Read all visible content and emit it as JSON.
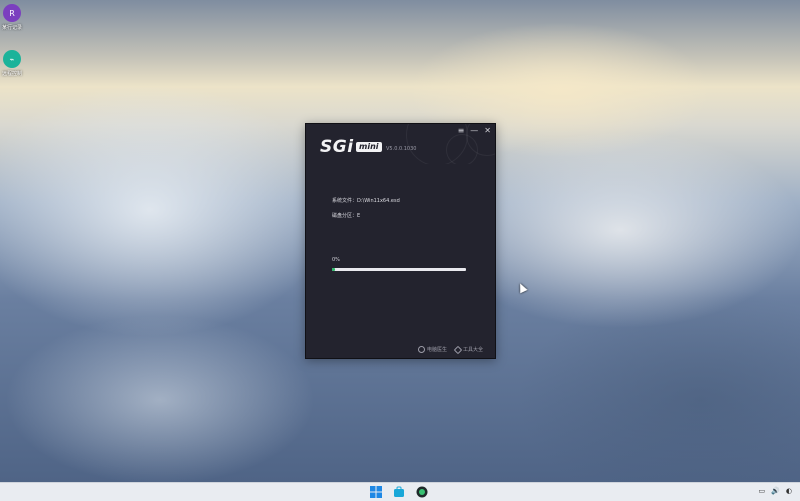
{
  "desktop": {
    "icons": [
      {
        "label": "某行记录",
        "color": "#7b3fbf",
        "glyph": "R"
      },
      {
        "label": "远程控制",
        "color": "#1bb39a",
        "glyph": "⌁"
      }
    ]
  },
  "window": {
    "logo_main": "SGi",
    "logo_badge": "mini",
    "version": "V5.0.0.1030",
    "controls": {
      "menu": "≡",
      "minimize": "—",
      "close": "✕"
    },
    "system_file_label": "系统文件：D:\\Win11x64.esd",
    "partition_label": "磁盘分区：E",
    "progress_text": "0%",
    "progress_value": 0.02,
    "footer": {
      "item1": "电脑医生",
      "item2": "工具大全"
    }
  },
  "taskbar": {
    "icons": [
      "windows-start-icon",
      "store-icon",
      "app-icon"
    ],
    "tray": [
      "▭",
      "🔊",
      "◐"
    ]
  },
  "colors": {
    "window_bg": "#23232e",
    "progress_fill": "#2fb86a",
    "progress_track": "#e9e9ee"
  }
}
